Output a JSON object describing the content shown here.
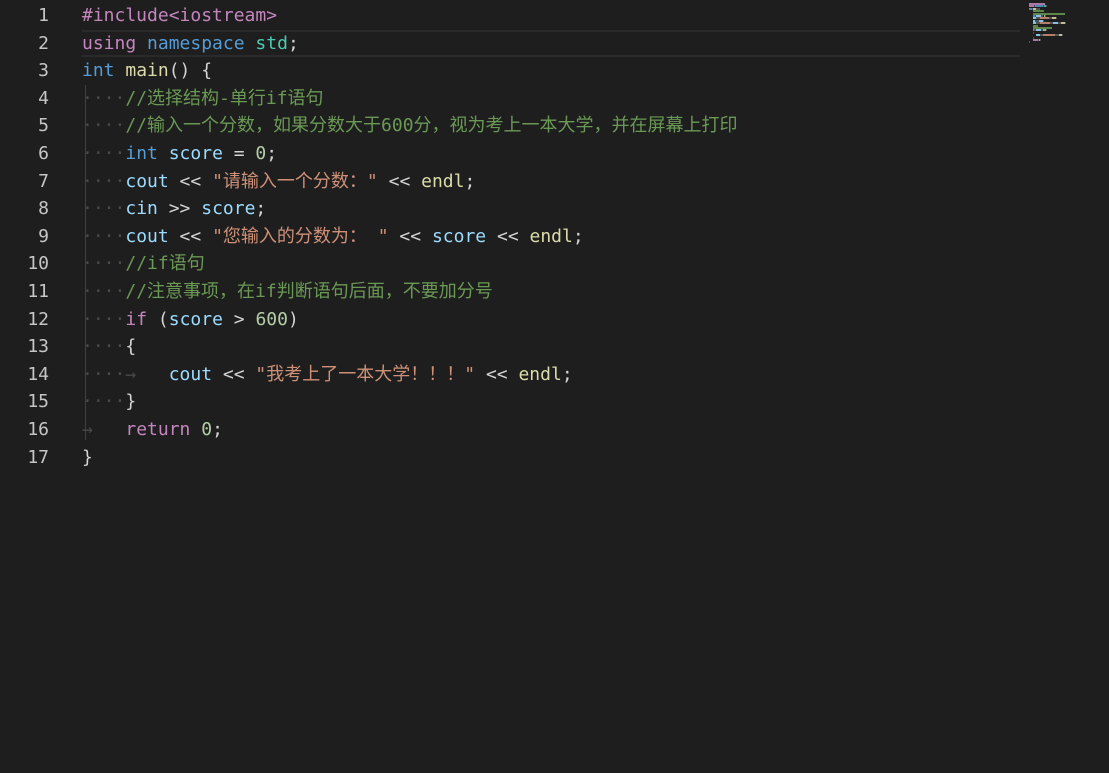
{
  "editor": {
    "language": "cpp",
    "current_line": 2,
    "line_numbers": [
      "1",
      "2",
      "3",
      "4",
      "5",
      "6",
      "7",
      "8",
      "9",
      "10",
      "11",
      "12",
      "13",
      "14",
      "15",
      "16",
      "17"
    ],
    "lines": [
      {
        "indent": "",
        "tokens": [
          [
            "pre",
            "#include<iostream>"
          ]
        ]
      },
      {
        "indent": "",
        "tokens": [
          [
            "ctl",
            "using"
          ],
          [
            "op",
            " "
          ],
          [
            "kw",
            "namespace"
          ],
          [
            "op",
            " "
          ],
          [
            "ns",
            "std"
          ],
          [
            "op",
            ";"
          ]
        ]
      },
      {
        "indent": "",
        "tokens": [
          [
            "kw",
            "int"
          ],
          [
            "op",
            " "
          ],
          [
            "fn",
            "main"
          ],
          [
            "op",
            "() {"
          ]
        ]
      },
      {
        "indent": "····",
        "tokens": [
          [
            "cmt",
            "//选择结构-单行if语句"
          ]
        ]
      },
      {
        "indent": "····",
        "tokens": [
          [
            "cmt",
            "//输入一个分数，如果分数大于600分，视为考上一本大学，并在屏幕上打印"
          ]
        ]
      },
      {
        "indent": "····",
        "tokens": [
          [
            "kw",
            "int"
          ],
          [
            "op",
            " "
          ],
          [
            "var",
            "score"
          ],
          [
            "op",
            " = "
          ],
          [
            "num",
            "0"
          ],
          [
            "op",
            ";"
          ]
        ]
      },
      {
        "indent": "····",
        "tokens": [
          [
            "var",
            "cout"
          ],
          [
            "op",
            " << "
          ],
          [
            "str",
            "\"请输入一个分数：\""
          ],
          [
            "op",
            " << "
          ],
          [
            "fn",
            "endl"
          ],
          [
            "op",
            ";"
          ]
        ]
      },
      {
        "indent": "····",
        "tokens": [
          [
            "var",
            "cin"
          ],
          [
            "op",
            " >> "
          ],
          [
            "var",
            "score"
          ],
          [
            "op",
            ";"
          ]
        ]
      },
      {
        "indent": "····",
        "tokens": [
          [
            "var",
            "cout"
          ],
          [
            "op",
            " << "
          ],
          [
            "str",
            "\"您输入的分数为： \""
          ],
          [
            "op",
            " << "
          ],
          [
            "var",
            "score"
          ],
          [
            "op",
            " << "
          ],
          [
            "fn",
            "endl"
          ],
          [
            "op",
            ";"
          ]
        ]
      },
      {
        "indent": "····",
        "tokens": [
          [
            "cmt",
            "//if语句"
          ]
        ]
      },
      {
        "indent": "····",
        "tokens": [
          [
            "cmt",
            "//注意事项，在if判断语句后面，不要加分号"
          ]
        ]
      },
      {
        "indent": "····",
        "tokens": [
          [
            "ctl",
            "if"
          ],
          [
            "op",
            " ("
          ],
          [
            "var",
            "score"
          ],
          [
            "op",
            " > "
          ],
          [
            "num",
            "600"
          ],
          [
            "op",
            ")"
          ]
        ]
      },
      {
        "indent": "····",
        "tokens": [
          [
            "op",
            "{"
          ]
        ]
      },
      {
        "indent": "····→   ",
        "tokens": [
          [
            "var",
            "cout"
          ],
          [
            "op",
            " << "
          ],
          [
            "str",
            "\"我考上了一本大学！！！\""
          ],
          [
            "op",
            " << "
          ],
          [
            "fn",
            "endl"
          ],
          [
            "op",
            ";"
          ]
        ]
      },
      {
        "indent": "····",
        "tokens": [
          [
            "op",
            "}"
          ]
        ]
      },
      {
        "indent": "→   ",
        "tokens": [
          [
            "ctl",
            "return"
          ],
          [
            "op",
            " "
          ],
          [
            "num",
            "0"
          ],
          [
            "op",
            ";"
          ]
        ]
      },
      {
        "indent": "",
        "tokens": [
          [
            "op",
            "}"
          ]
        ]
      }
    ]
  },
  "theme": {
    "background": "#1e1e1e",
    "line_number": "#c6c6c6",
    "keyword": "#569cd6",
    "control": "#c586c0",
    "function": "#dcdcaa",
    "variable": "#9cdcfe",
    "number": "#b5cea8",
    "string": "#ce9178",
    "comment": "#6a9955"
  }
}
